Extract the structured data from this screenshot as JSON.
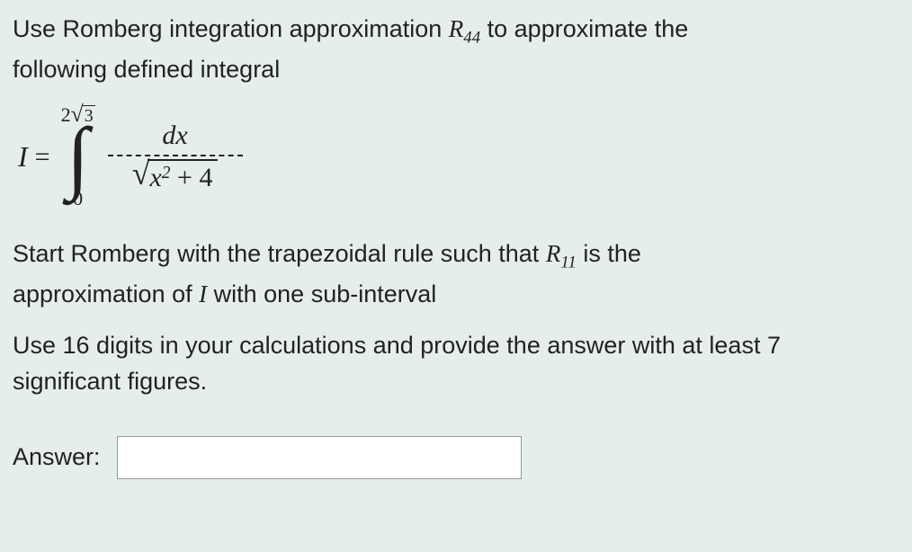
{
  "question": {
    "intro_line1": "Use Romberg integration approximation ",
    "intro_r": "R",
    "intro_sub": "44",
    "intro_line1_end": " to approximate the",
    "intro_line2": "following defined integral",
    "integral": {
      "lhs": "I",
      "upper_coef": "2",
      "upper_sqrt": "3",
      "lower": "0",
      "numerator": "dx",
      "denom_inside": "x",
      "denom_exp": "2",
      "denom_plus": " + 4"
    },
    "start_text_a": "Start Romberg with the trapezoidal rule such that ",
    "start_r": "R",
    "start_sub": "11",
    "start_text_b": " is the",
    "start_line2_a": "approximation of ",
    "start_I": "I",
    "start_line2_b": " with one sub-interval",
    "digits_line1": "Use 16 digits in your calculations and provide the answer with at least 7",
    "digits_line2": "significant figures."
  },
  "answer": {
    "label": "Answer:",
    "value": ""
  }
}
